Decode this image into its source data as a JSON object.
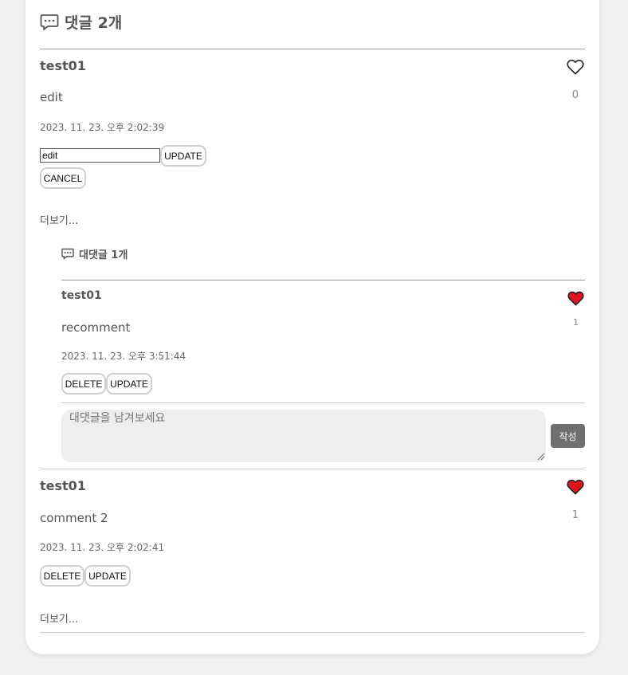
{
  "section": {
    "title": "댓글 2개"
  },
  "comments": [
    {
      "author": "test01",
      "body": "edit",
      "date": "2023. 11. 23. 오후 2:02:39",
      "likes": "0",
      "liked": false,
      "edit_value": "edit",
      "update_label": "UPDATE",
      "cancel_label": "CANCEL",
      "more_label": "더보기...",
      "replies_title": "대댓글 1개",
      "replies": [
        {
          "author": "test01",
          "body": "recomment",
          "date": "2023. 11. 23. 오후 3:51:44",
          "likes": "1",
          "liked": true,
          "delete_label": "DELETE",
          "update_label": "UPDATE"
        }
      ],
      "reply_placeholder": "대댓글을 남겨보세요",
      "reply_submit_label": "작성"
    },
    {
      "author": "test01",
      "body": "comment 2",
      "date": "2023. 11. 23. 오후 2:02:41",
      "likes": "1",
      "liked": true,
      "delete_label": "DELETE",
      "update_label": "UPDATE",
      "more_label": "더보기..."
    }
  ],
  "colors": {
    "heart_filled": "#e0141e",
    "submit_button": "#6f6f6f"
  },
  "icons": {
    "section": "speech-bubble-icon",
    "reply_section": "speech-bubble-icon",
    "like": "heart-icon"
  }
}
